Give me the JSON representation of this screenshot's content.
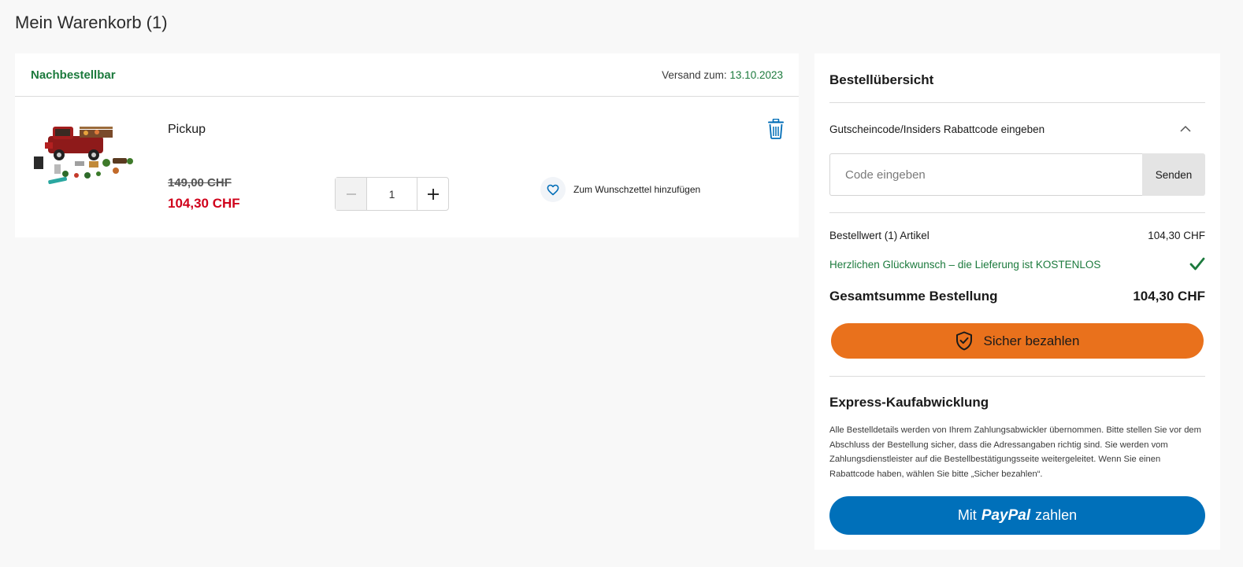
{
  "page": {
    "title": "Mein Warenkorb (1)"
  },
  "cart": {
    "availability": "Nachbestellbar",
    "shipping_label": "Versand zum:",
    "shipping_date": "13.10.2023",
    "item": {
      "name": "Pickup",
      "price_old": "149,00 CHF",
      "price_new": "104,30 CHF",
      "quantity": "1",
      "wishlist_label": "Zum Wunschzettel hinzufügen"
    }
  },
  "summary": {
    "title": "Bestellübersicht",
    "coupon_label": "Gutscheincode/Insiders Rabattcode eingeben",
    "coupon_placeholder": "Code eingeben",
    "coupon_submit": "Senden",
    "order_value_label": "Bestellwert (1) Artikel",
    "order_value": "104,30 CHF",
    "free_shipping_text": "Herzlichen Glückwunsch – die Lieferung ist KOSTENLOS",
    "total_label": "Gesamtsumme Bestellung",
    "total_value": "104,30 CHF",
    "pay_button": "Sicher bezahlen",
    "express_title": "Express-Kaufabwicklung",
    "express_text": "Alle Bestelldetails werden von Ihrem Zahlungsabwickler übernommen. Bitte stellen Sie vor dem Abschluss der Bestellung sicher, dass die Adressangaben richtig sind. Sie werden vom Zahlungsdienstleister auf die Bestellbestätigungsseite weitergeleitet. Wenn Sie einen Rabattcode haben, wählen Sie bitte „Sicher bezahlen“.",
    "paypal_prefix": "Mit",
    "paypal_brand": "PayPal",
    "paypal_suffix": "zahlen"
  },
  "colors": {
    "accent_green": "#1c7a3d",
    "sale_red": "#d0021b",
    "pay_orange": "#e9711c",
    "paypal_blue": "#0070ba",
    "icon_blue": "#006db7"
  },
  "icons": [
    "trash-icon",
    "heart-icon",
    "minus-icon",
    "plus-icon",
    "chevron-up-icon",
    "checkmark-icon",
    "shield-check-icon"
  ]
}
